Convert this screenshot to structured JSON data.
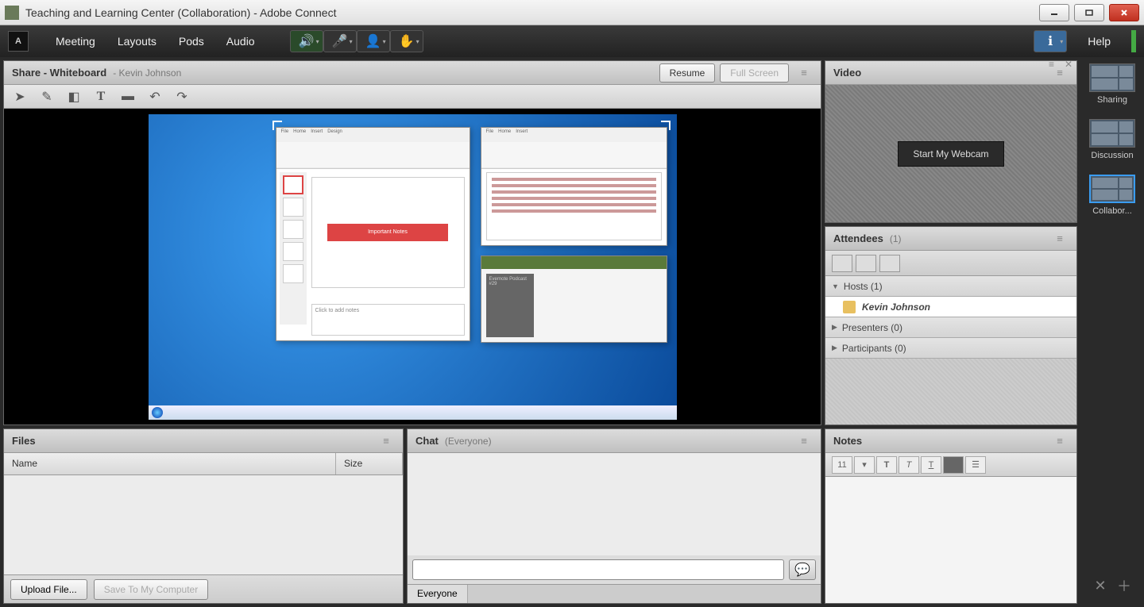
{
  "window": {
    "title": "Teaching and Learning Center (Collaboration) - Adobe Connect"
  },
  "menu": {
    "logo": "A",
    "items": [
      "Meeting",
      "Layouts",
      "Pods",
      "Audio"
    ],
    "help": "Help"
  },
  "share": {
    "title": "Share - Whiteboard",
    "presenter": "- Kevin Johnson",
    "resume": "Resume",
    "fullscreen": "Full Screen",
    "slide_banner": "Important Notes",
    "notes_placeholder": "Click to add notes"
  },
  "video": {
    "title": "Video",
    "button": "Start My Webcam"
  },
  "attendees": {
    "title": "Attendees",
    "count": "(1)",
    "groups": {
      "hosts": {
        "label": "Hosts (1)",
        "expanded": true,
        "members": [
          "Kevin Johnson"
        ]
      },
      "presenters": {
        "label": "Presenters (0)"
      },
      "participants": {
        "label": "Participants (0)"
      }
    }
  },
  "files": {
    "title": "Files",
    "col_name": "Name",
    "col_size": "Size",
    "upload": "Upload File...",
    "save": "Save To My Computer"
  },
  "chat": {
    "title": "Chat",
    "scope": "(Everyone)",
    "tab": "Everyone"
  },
  "notes": {
    "title": "Notes",
    "font_size": "11"
  },
  "layouts": {
    "sharing": "Sharing",
    "discussion": "Discussion",
    "collabor": "Collabor...",
    "active": "collabor"
  }
}
